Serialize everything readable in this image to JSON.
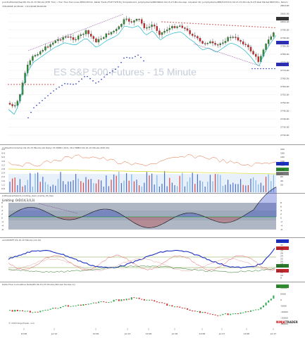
{
  "main": {
    "title": "Jun15ndMarket(Sep18) 09-15-15 Minute (RTH Tick) • Tran Tran Tran-Lines BPOC/ZCOC, Retail Trade (FIVE FIVE Ex) Simplebook4, JumpSystems/BRONDAS 09-15-15-Minute-Gap, Adjusted 2D, JumpSystems/PPR/DU/5/10) 09-15-15-Minute:8-2(5 Real Market BRKT-Trio, Return",
    "subtitle": "7/31/2018 12:30:00 - 7/17/2018 09:00:00",
    "watermark": "ES    S&P 500 Futures - 15 Minute",
    "price_labels": [
      "2810.00",
      "2805.00",
      "2800.00",
      "2795.00",
      "2790.00",
      "2785.00",
      "2780.00",
      "2775.00",
      "2770.00",
      "2765.00",
      "2760.00",
      "2755.00",
      "2750.00",
      "2745.00",
      "2740.00",
      "2735.00",
      "2730.00"
    ],
    "current_price": "2803.75",
    "mid_tag": "2796.00",
    "low_tag": "2789.25"
  },
  "volume": {
    "title": "2.4(SectionVolume) 09-15-15 Minute (All Daily) VX PZMO (013), ShorTRBIO 09-15-15 Minute (Rthl 20)",
    "axis": [
      "4.8",
      "4.4",
      "4.0",
      "3.6",
      "3.2",
      "2.8",
      "2.4",
      "2.0",
      "1.6",
      "1.2",
      "0.8"
    ],
    "right_axis": [
      "200",
      "180",
      "160",
      "140",
      "120",
      "100",
      "80",
      "60",
      "40",
      "20"
    ],
    "tag1": "161.24",
    "tag2": "138.88",
    "tag3": "14.77"
  },
  "osc": {
    "title": "(LRSquaredVal)10_Limiting_Gam_Inertia_03_Gen",
    "subtitle": "Limiting: OrD(14,3,0,3)",
    "axis": [
      "8",
      "6",
      "4",
      "2",
      "0",
      "-2",
      "-4",
      "-6"
    ]
  },
  "rsi": {
    "title": "emoDSHIFT 09-15-15 Minute (14,14)",
    "axis": [
      "34",
      "32",
      "30",
      "28",
      "26",
      "24",
      "22",
      "20",
      "18",
      "16",
      "14",
      "12",
      "10",
      "8"
    ],
    "tag1": "34.02",
    "tag2": "22.33",
    "tag3": "16.13",
    "tag4": "11.27"
  },
  "cum": {
    "title": "Delta Flow Cumulative Delta(ES 09-15-15 Minute [Bid Ask Tendee 1])",
    "axis": [
      "10000",
      "5000",
      "0",
      "-5000",
      "-10000",
      "-15000",
      "-20000"
    ],
    "tag": "11"
  },
  "x_labels": [
    "12:00",
    "Jul 12",
    "12:00",
    "Jul 13",
    "12:00",
    "Jul 16",
    "12:00",
    "Jul 17",
    "12:00",
    "Jul 17"
  ],
  "footer": {
    "copyright": "© 2018 NinjaTrader, LLC",
    "brand_a": "NINJA",
    "brand_b": "TRADER"
  },
  "colors": {
    "up": "#2e8b2e",
    "down": "#d0282a",
    "blue": "#1a2fc4",
    "cyan": "#20b7c7",
    "grid": "#e6e6e6"
  }
}
